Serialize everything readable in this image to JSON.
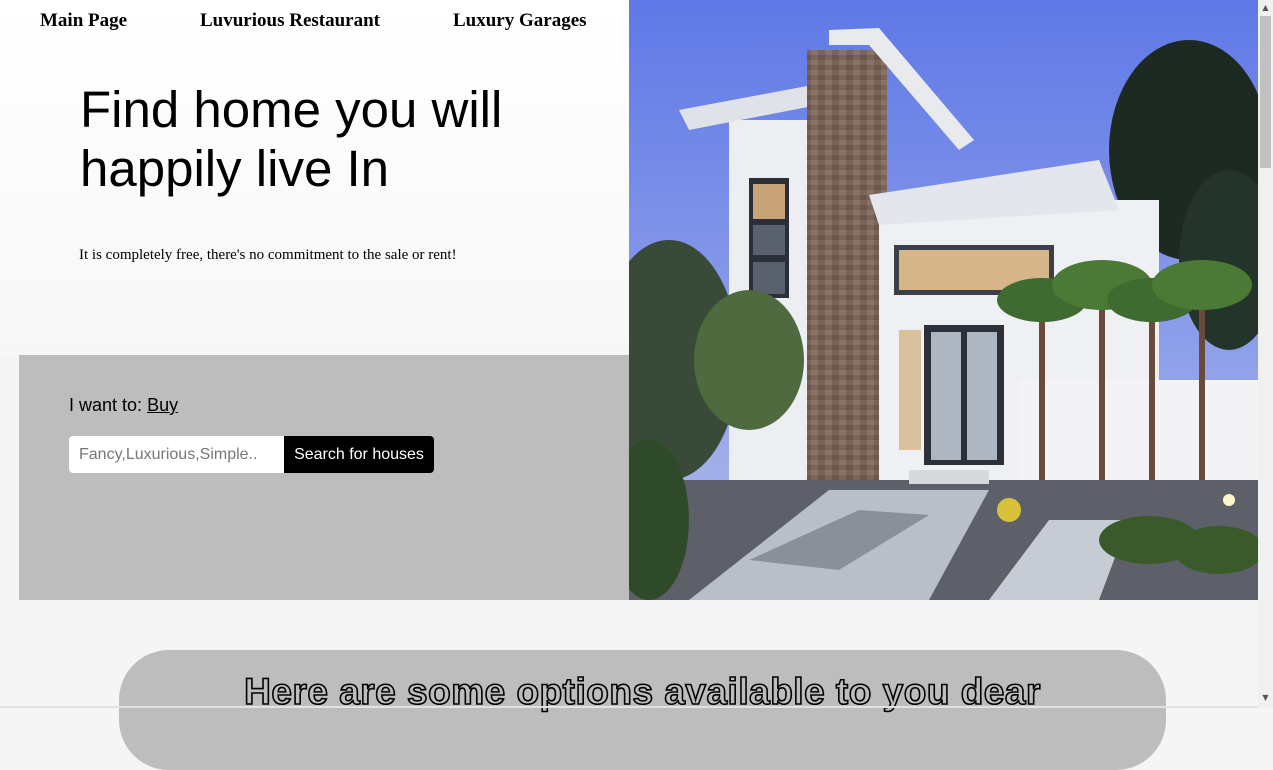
{
  "nav": {
    "items": [
      {
        "label": "Main Page"
      },
      {
        "label": "Luvurious Restaurant"
      },
      {
        "label": "Luxury Garages"
      }
    ]
  },
  "hero": {
    "title": "Find home you will happily live In",
    "subtitle": "It is completely free, there's no commitment to the sale or rent!",
    "image_description": "modern-luxury-house-photo"
  },
  "search": {
    "want_label": "I want to:",
    "want_value": "Buy",
    "placeholder": "Fancy,Luxurious,Simple..",
    "value": "",
    "button_label": "Search for houses"
  },
  "options": {
    "title": "Here are some options available to you dear"
  },
  "colors": {
    "panel_gray": "#bdbdbd",
    "button_bg": "#000000",
    "sky": "#6f86e0"
  },
  "scrollbar": {
    "up_icon": "triangle-up-icon",
    "down_icon": "triangle-down-icon"
  }
}
